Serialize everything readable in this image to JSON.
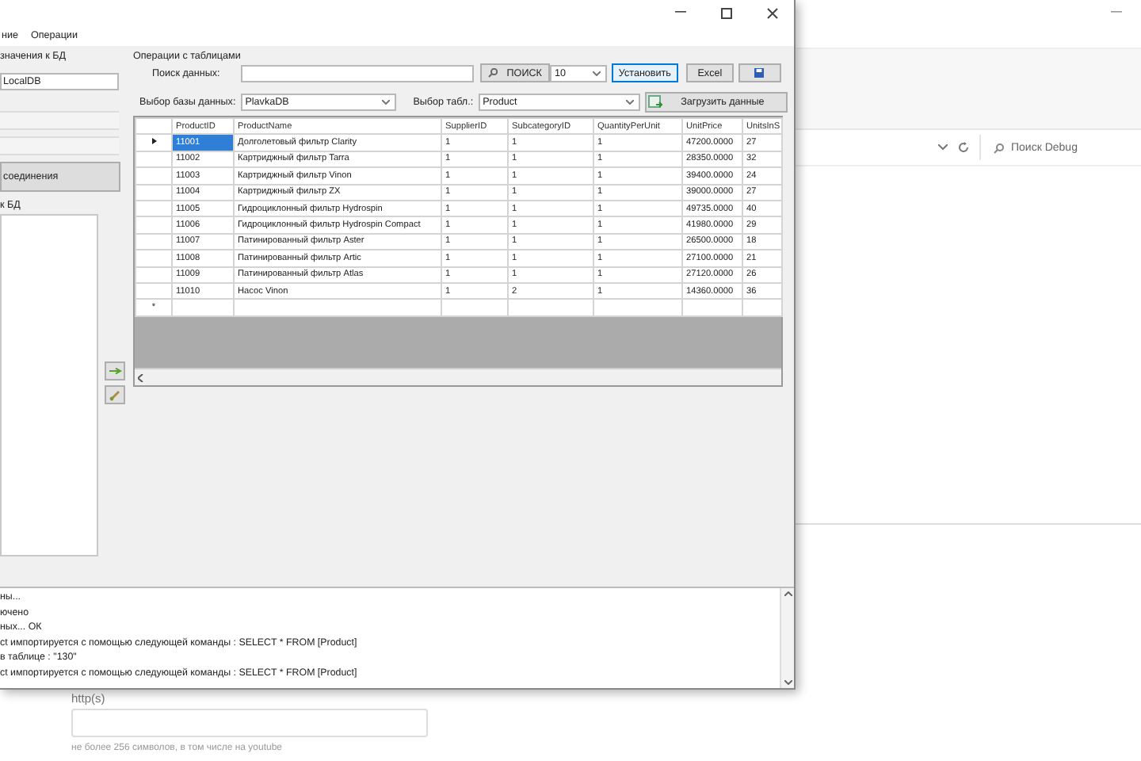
{
  "app_window": {
    "menu": [
      "ние",
      "Операции"
    ],
    "connection": {
      "label": "значения к БД",
      "server_value": "LocalDB",
      "button": "соединения",
      "db_list_label": "к БД"
    },
    "operations": {
      "title": "Операции с таблицами",
      "search_label": "Поиск данных:",
      "search_button": "ПОИСК",
      "count_value": "10",
      "set_button": "Установить",
      "excel_button": "Excel",
      "db_label": "Выбор базы данных:",
      "db_value": "PlavkaDB",
      "table_label": "Выбор табл.:",
      "table_value": "Product",
      "load_button": "Загрузить данные"
    },
    "table": {
      "columns": [
        "ProductID",
        "ProductName",
        "SupplierID",
        "SubcategoryID",
        "QuantityPerUnit",
        "UnitPrice",
        "UnitsInS"
      ],
      "rows": [
        {
          "selected": true,
          "cells": [
            "11001",
            "Долголетовый фильтр Clarity",
            "1",
            "1",
            "1",
            "47200.0000",
            "27"
          ]
        },
        {
          "selected": false,
          "cells": [
            "11002",
            "Картриджный фильтр Tarra",
            "1",
            "1",
            "1",
            "28350.0000",
            "32"
          ]
        },
        {
          "selected": false,
          "cells": [
            "11003",
            "Картриджный фильтр Vinon",
            "1",
            "1",
            "1",
            "39400.0000",
            "24"
          ]
        },
        {
          "selected": false,
          "cells": [
            "11004",
            "Картриджный фильтр ZX",
            "1",
            "1",
            "1",
            "39000.0000",
            "27"
          ]
        },
        {
          "selected": false,
          "cells": [
            "11005",
            "Гидроциклонный фильтр Hydrospin",
            "1",
            "1",
            "1",
            "49735.0000",
            "40"
          ]
        },
        {
          "selected": false,
          "cells": [
            "11006",
            "Гидроциклонный фильтр Hydrospin Compact",
            "1",
            "1",
            "1",
            "41980.0000",
            "29"
          ]
        },
        {
          "selected": false,
          "cells": [
            "11007",
            "Патинированный фильтр Aster",
            "1",
            "1",
            "1",
            "26500.0000",
            "18"
          ]
        },
        {
          "selected": false,
          "cells": [
            "11008",
            "Патинированный фильтр Artic",
            "1",
            "1",
            "1",
            "27100.0000",
            "21"
          ]
        },
        {
          "selected": false,
          "cells": [
            "11009",
            "Патинированный фильтр Atlas",
            "1",
            "1",
            "1",
            "27120.0000",
            "26"
          ]
        },
        {
          "selected": false,
          "cells": [
            "11010",
            "Насос Vinon",
            "1",
            "2",
            "1",
            "14360.0000",
            "36"
          ]
        }
      ],
      "new_row_marker": "*"
    },
    "log": {
      "lines": [
        "ны...",
        "ючено",
        "ных... ОК",
        "ct импортируется с помощью следующей команды : SELECT * FROM [Product]",
        "в таблице : \"130\"",
        "ct импортируется с помощью следующей команды : SELECT * FROM [Product]"
      ]
    }
  },
  "debug_window": {
    "search_placeholder": "Поиск Debug"
  },
  "web_form": {
    "label": "http(s)",
    "hint": "не более 256 символов, в том числе на youtube"
  }
}
